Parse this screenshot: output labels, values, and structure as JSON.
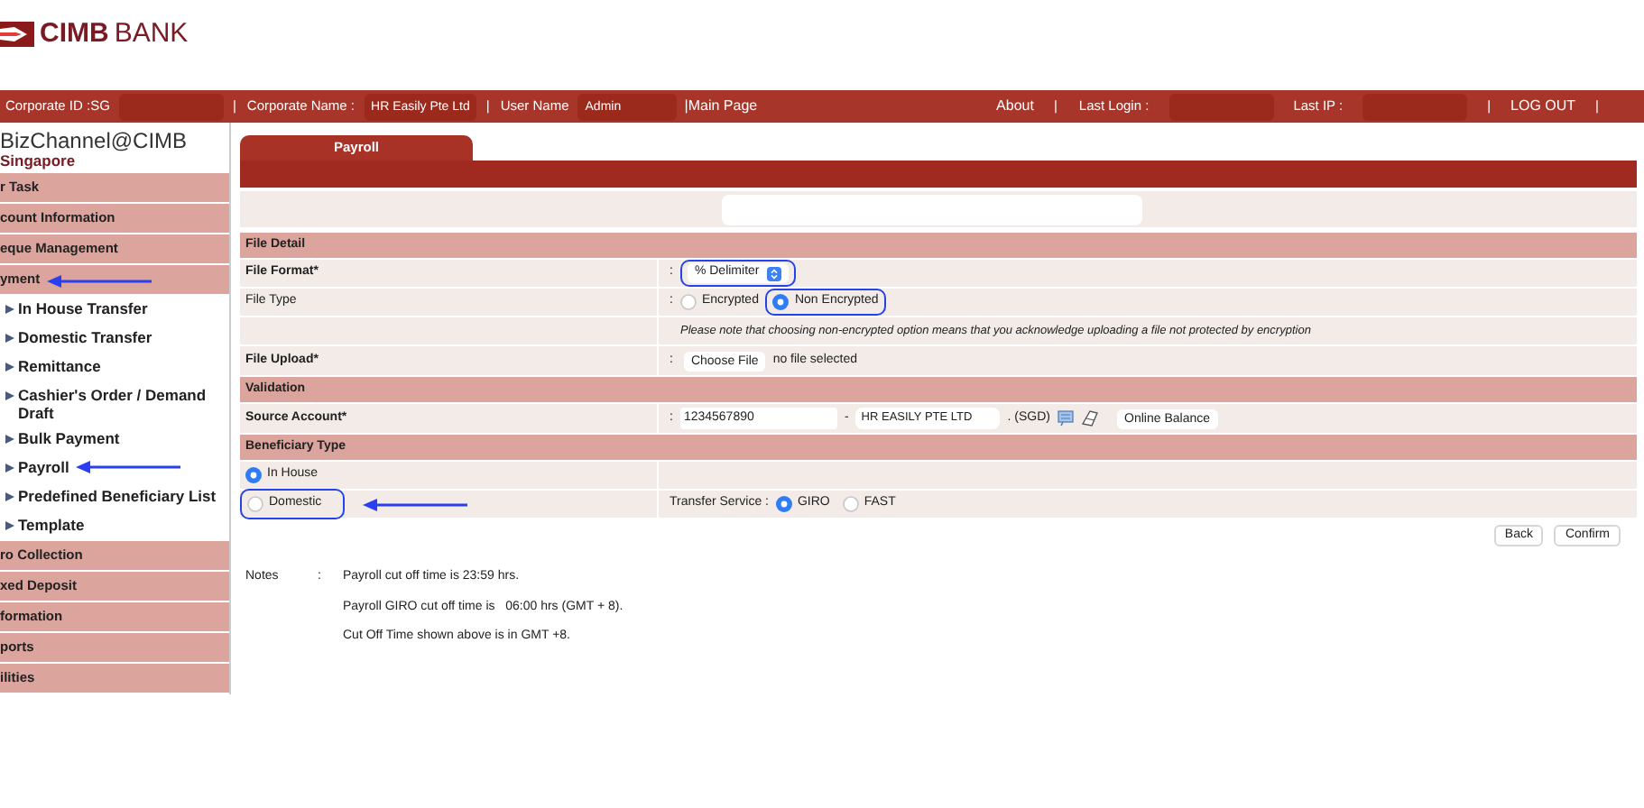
{
  "logo": {
    "brand": "CIMB",
    "suffix": "BANK"
  },
  "header": {
    "left": [
      {
        "kind": "text",
        "text": "Corporate ID :SG"
      },
      {
        "kind": "redacted"
      },
      {
        "kind": "text",
        "text": "|"
      },
      {
        "kind": "text",
        "text": "Corporate Name :"
      },
      {
        "kind": "field",
        "text": "HR Easily Pte Ltd"
      },
      {
        "kind": "text",
        "text": "|"
      },
      {
        "kind": "text",
        "text": "User Name"
      },
      {
        "kind": "field",
        "text": "Admin"
      },
      {
        "kind": "link",
        "text": "|Main Page"
      }
    ],
    "right": [
      {
        "kind": "link",
        "text": "About"
      },
      {
        "kind": "text",
        "text": "|"
      },
      {
        "kind": "text",
        "text": "Last Login :"
      },
      {
        "kind": "redacted"
      },
      {
        "kind": "text",
        "text": "Last IP :"
      },
      {
        "kind": "redacted"
      },
      {
        "kind": "text",
        "text": "|"
      },
      {
        "kind": "link",
        "text": "LOG OUT"
      },
      {
        "kind": "text",
        "text": "|"
      }
    ]
  },
  "sidebar": {
    "title": "BizChannel@CIMB",
    "subtitle": "Singapore",
    "items": [
      {
        "kind": "section",
        "label": "r Task",
        "arrow": false
      },
      {
        "kind": "section",
        "label": "count Information",
        "arrow": false
      },
      {
        "kind": "section",
        "label": "eque Management",
        "arrow": false
      },
      {
        "kind": "section",
        "label": "yment",
        "arrow": true
      },
      {
        "kind": "sub",
        "label": "In House Transfer",
        "arrow": false
      },
      {
        "kind": "sub",
        "label": "Domestic Transfer",
        "arrow": false
      },
      {
        "kind": "sub",
        "label": "Remittance",
        "arrow": false
      },
      {
        "kind": "sub",
        "label": "Cashier's Order / Demand Draft",
        "arrow": false
      },
      {
        "kind": "sub",
        "label": "Bulk Payment",
        "arrow": false
      },
      {
        "kind": "sub",
        "label": "Payroll",
        "arrow": true
      },
      {
        "kind": "sub",
        "label": "Predefined Beneficiary List",
        "arrow": false
      },
      {
        "kind": "sub",
        "label": "Template",
        "arrow": false
      },
      {
        "kind": "section",
        "label": "ro Collection",
        "arrow": false
      },
      {
        "kind": "section",
        "label": "xed Deposit",
        "arrow": false
      },
      {
        "kind": "section",
        "label": "formation",
        "arrow": false
      },
      {
        "kind": "section",
        "label": "ports",
        "arrow": false
      },
      {
        "kind": "section",
        "label": "ilities",
        "arrow": false
      }
    ]
  },
  "tabs": [
    {
      "label": "Payroll",
      "selected": true
    }
  ],
  "form": {
    "rows": [
      {
        "kind": "section",
        "label": "File Detail"
      },
      {
        "kind": "select",
        "label": "File Format*",
        "bold": true,
        "colon": ":",
        "value": "% Delimiter",
        "highlighted": true
      },
      {
        "kind": "radios",
        "label": "File Type",
        "bold": false,
        "colon": ":",
        "options": [
          {
            "label": "Encrypted",
            "selected": false,
            "highlighted": false
          },
          {
            "label": "Non Encrypted",
            "selected": true,
            "highlighted": true
          }
        ]
      },
      {
        "kind": "note",
        "text": "Please note that choosing non-encrypted option means that you acknowledge uploading a file not protected by encryption"
      },
      {
        "kind": "file",
        "label": "File Upload*",
        "bold": true,
        "colon": ":",
        "button": "Choose File",
        "status": "no file selected"
      },
      {
        "kind": "section",
        "label": "Validation"
      },
      {
        "kind": "account",
        "label": "Source Account*",
        "bold": true,
        "colon": ":",
        "account": "1234567890",
        "separator": "-",
        "name": "HR EASILY PTE LTD",
        "currency": ". (SGD)",
        "button": "Online Balance"
      },
      {
        "kind": "section",
        "label": "Beneficiary Type"
      },
      {
        "kind": "choice",
        "option": {
          "label": "In House",
          "selected": true,
          "highlighted": false,
          "arrow": false
        }
      },
      {
        "kind": "choice",
        "option": {
          "label": "Domestic",
          "selected": false,
          "highlighted": true,
          "arrow": true
        },
        "service": {
          "label": "Transfer Service :",
          "options": [
            {
              "label": "GIRO",
              "selected": true
            },
            {
              "label": "FAST",
              "selected": false
            }
          ]
        }
      }
    ]
  },
  "buttons": [
    "Back",
    "Confirm"
  ],
  "notes": {
    "label": "Notes",
    "colon": ":",
    "lines": [
      "Payroll cut off time is 23:59 hrs.",
      "Payroll GIRO cut off time is   06:00 hrs (GMT + 8).",
      "Cut Off Time shown above is in GMT +8."
    ]
  }
}
